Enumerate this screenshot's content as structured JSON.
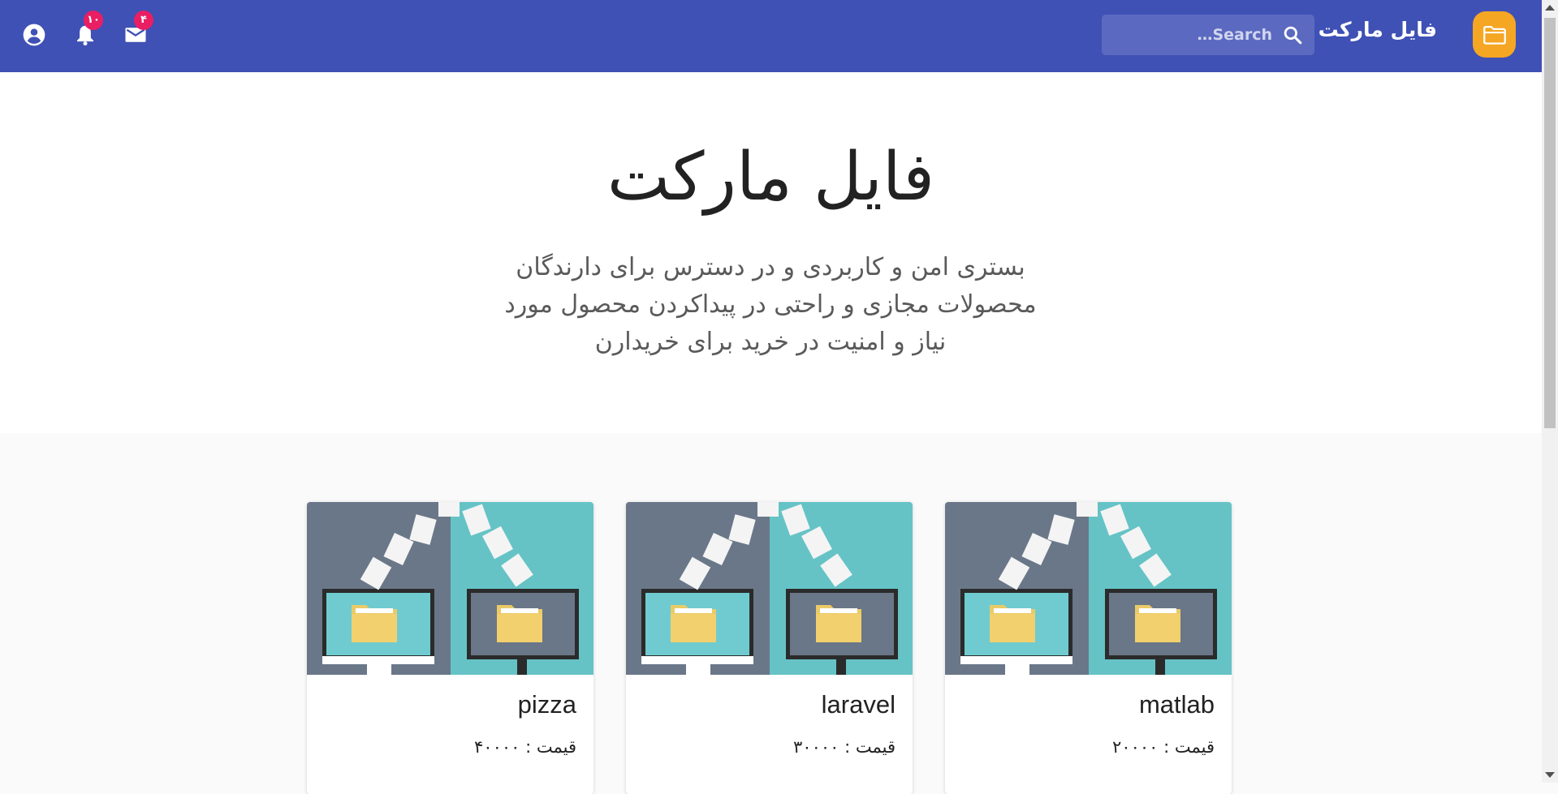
{
  "colors": {
    "appbar": "#3f51b5",
    "logo_bg": "#f5a623",
    "badge": "#e91e63",
    "hero_bg": "#ffffff",
    "page_bg": "#fafafa"
  },
  "appbar": {
    "brand": "فایل مارکت",
    "logo_icon": "folder-icon",
    "search": {
      "placeholder": "Search…",
      "icon": "search-icon"
    },
    "mail": {
      "icon": "mail-icon",
      "badge": "۴"
    },
    "notifications": {
      "icon": "bell-icon",
      "badge": "۱۰"
    },
    "account": {
      "icon": "account-circle-icon"
    }
  },
  "hero": {
    "title": "فایل مارکت",
    "subtitle": "بستری امن و کاربردی و در دسترس برای دارندگان محصولات مجازی و راحتی در پیداکردن محصول مورد نیاز و امنیت در خرید برای خریدارن"
  },
  "products": [
    {
      "title": "matlab",
      "price_label": "قیمت : ۲۰۰۰۰"
    },
    {
      "title": "laravel",
      "price_label": "قیمت : ۳۰۰۰۰"
    },
    {
      "title": "pizza",
      "price_label": "قیمت : ۴۰۰۰۰"
    }
  ]
}
